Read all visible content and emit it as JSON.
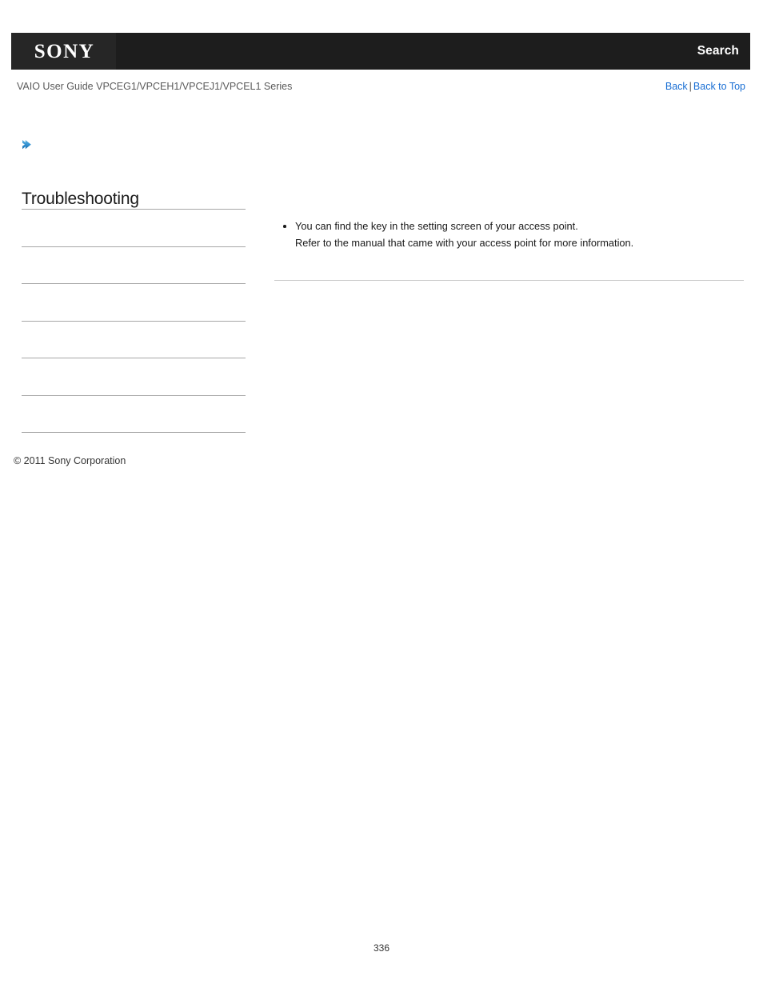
{
  "header": {
    "logo_text": "SONY",
    "logo_icon": "sony-wordmark",
    "search_label": "Search"
  },
  "subheader": {
    "guide_title": "VAIO User Guide VPCEG1/VPCEH1/VPCEJ1/VPCEL1 Series",
    "back_label": "Back",
    "separator": "|",
    "back_to_top_label": "Back to Top"
  },
  "sidebar": {
    "breadcrumb_icon": "chevron-right-icon",
    "section_title": "Troubleshooting",
    "items": [
      {
        "label": ""
      },
      {
        "label": ""
      },
      {
        "label": ""
      },
      {
        "label": ""
      },
      {
        "label": ""
      },
      {
        "label": ""
      }
    ],
    "copyright": "© 2011 Sony Corporation"
  },
  "main": {
    "bullets": [
      {
        "lines": [
          "You can find the key in the setting screen of your access point.",
          "Refer to the manual that came with your access point for more information."
        ]
      }
    ]
  },
  "footer": {
    "page_number": "336"
  },
  "colors": {
    "header_bar": "#1d1d1d",
    "logo_block": "#262626",
    "link": "#1a6fd4",
    "accent_arrow": "#2f8fd0",
    "rule": "#a7a7a7",
    "content_rule": "#cccccc"
  }
}
